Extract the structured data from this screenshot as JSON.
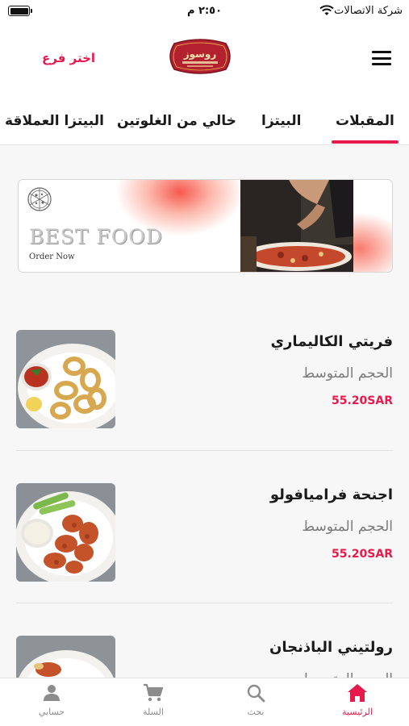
{
  "status_bar": {
    "carrier": "شركة الاتصالات",
    "time": "٢:٥٠ م",
    "icons": [
      "battery-icon",
      "wifi-icon"
    ]
  },
  "header": {
    "menu_icon": "hamburger-menu-icon",
    "logo_text": "روسوز",
    "branch_button": "اختر فرع"
  },
  "tabs": [
    {
      "label": "المقبلات",
      "active": true
    },
    {
      "label": "البيتزا",
      "active": false
    },
    {
      "label": "خالي من الغلوتين",
      "active": false
    },
    {
      "label": "البيتزا العملاقة",
      "active": false
    }
  ],
  "banner": {
    "title": "BEST FOOD",
    "subtitle": "Order Now"
  },
  "items": [
    {
      "name": "فريتي الكاليماري",
      "size": "الحجم المتوسط",
      "price": "55.20SAR",
      "image": "calamari-photo"
    },
    {
      "name": "اجنحة فراميافولو",
      "size": "الحجم المتوسط",
      "price": "55.20SAR",
      "image": "wings-photo"
    },
    {
      "name": "رولتيني الباذنجان",
      "size": "الحجم المتوسط",
      "price": "",
      "image": "eggplant-photo"
    }
  ],
  "bottom_nav": [
    {
      "label": "الرئيسية",
      "icon": "home-icon",
      "active": true
    },
    {
      "label": "بحث",
      "icon": "search-icon",
      "active": false
    },
    {
      "label": "السلة",
      "icon": "cart-icon",
      "active": false
    },
    {
      "label": "حسابي",
      "icon": "person-icon",
      "active": false
    }
  ],
  "colors": {
    "accent": "#e8194b",
    "text": "#1a1a1a",
    "muted": "#7a7a7a",
    "background": "#f7f7f7"
  }
}
